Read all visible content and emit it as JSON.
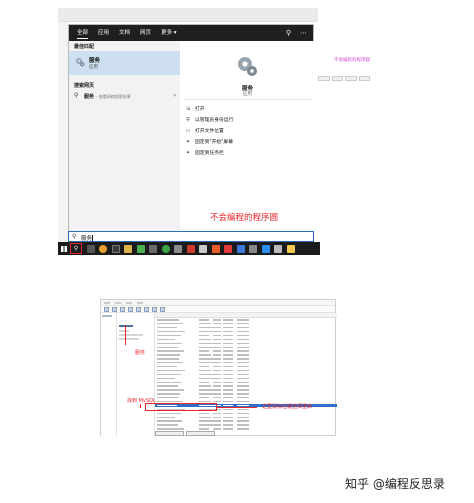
{
  "search": {
    "tabs": [
      "全部",
      "应用",
      "文档",
      "网页",
      "更多 ▾"
    ],
    "best_match_label": "最佳匹配",
    "best_match": {
      "title": "服务",
      "subtitle": "应用"
    },
    "web_label": "搜索网页",
    "web_item": {
      "keyword": "服务",
      "hint": "- 查看网络搜索结果",
      "arrow": "›"
    },
    "detail": {
      "title": "服务",
      "subtitle": "应用"
    },
    "actions": [
      {
        "icon": "open-icon",
        "glyph": "⇲",
        "label": "打开"
      },
      {
        "icon": "shield-icon",
        "glyph": "⛨",
        "label": "以管理员身份运行"
      },
      {
        "icon": "folder-icon",
        "glyph": "▭",
        "label": "打开文件位置"
      },
      {
        "icon": "pin-icon",
        "glyph": "✦",
        "label": "固定到\"开始\"屏幕"
      },
      {
        "icon": "taskbar-pin-icon",
        "glyph": "✦",
        "label": "固定到任务栏"
      }
    ],
    "watermark": "不会编程的程序圆",
    "query": "服务",
    "side_note": "不会编程的程序圆"
  },
  "services": {
    "annotations": {
      "services_label": "服务",
      "find_mysql": "找到 MySQL",
      "right_click_hint": "这里鼠标右键选择重启"
    }
  },
  "footer": {
    "watermark": "知乎 @编程反思录"
  },
  "colors": {
    "accent_blue": "#2a6fb8",
    "selection_blue": "#cddff0",
    "annotation_red": "#e6262e",
    "taskbar": "#1b1b1b",
    "note_pink": "#d64bd6"
  }
}
